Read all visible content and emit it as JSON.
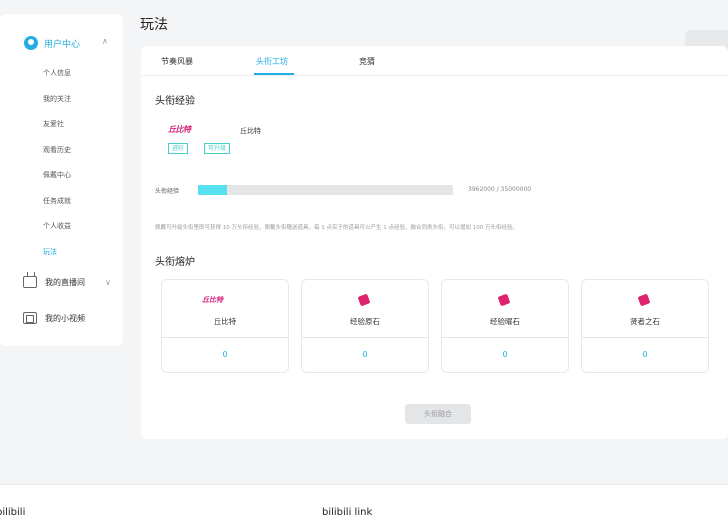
{
  "page_title": "玩法",
  "sidebar": {
    "header": "用户中心",
    "items": [
      "个人信息",
      "我的关注",
      "友爱社",
      "观看历史",
      "佩戴中心",
      "任务成就",
      "个人收益",
      "玩法"
    ],
    "active_index": 7,
    "groups": [
      {
        "label": "我的直播间",
        "icon": "tv-icon"
      },
      {
        "label": "我的小视频",
        "icon": "film-icon"
      }
    ]
  },
  "tabs": [
    "节奏风暴",
    "头衔工坊",
    "竞猜"
  ],
  "active_tab": 1,
  "exp_section": {
    "title": "头衔经验",
    "medal_text": "丘比特",
    "name": "丘比特",
    "tags": [
      "进阶",
      "可升级"
    ],
    "bar_label": "头衔经验",
    "progress_fraction": 0.113,
    "value_text": "3962000 / 35000000",
    "desc": "佩戴可升级头衔里即可获得 10 万头衔经验，佩戴头衔赠送道具，每 1 点实于的道具可以产生 1 点经验，融合同类头衔，可以增加 100 万头衔经验。"
  },
  "fuse_section": {
    "title": "头衔熔炉",
    "boxes": [
      {
        "name": "丘比特",
        "count": "0",
        "icon": "medal"
      },
      {
        "name": "经验原石",
        "count": "0",
        "icon": "gem-icon"
      },
      {
        "name": "经验曜石",
        "count": "0",
        "icon": "gem-icon"
      },
      {
        "name": "贤者之石",
        "count": "0",
        "icon": "gem-icon"
      }
    ],
    "button": "头衔融合"
  },
  "footer": {
    "left": "bilibili",
    "middle": "bilibili link"
  },
  "colors": {
    "accent": "#23ade5",
    "gem": "#e0236f",
    "medal": "#d4237a",
    "progress": "#56e0f0"
  }
}
